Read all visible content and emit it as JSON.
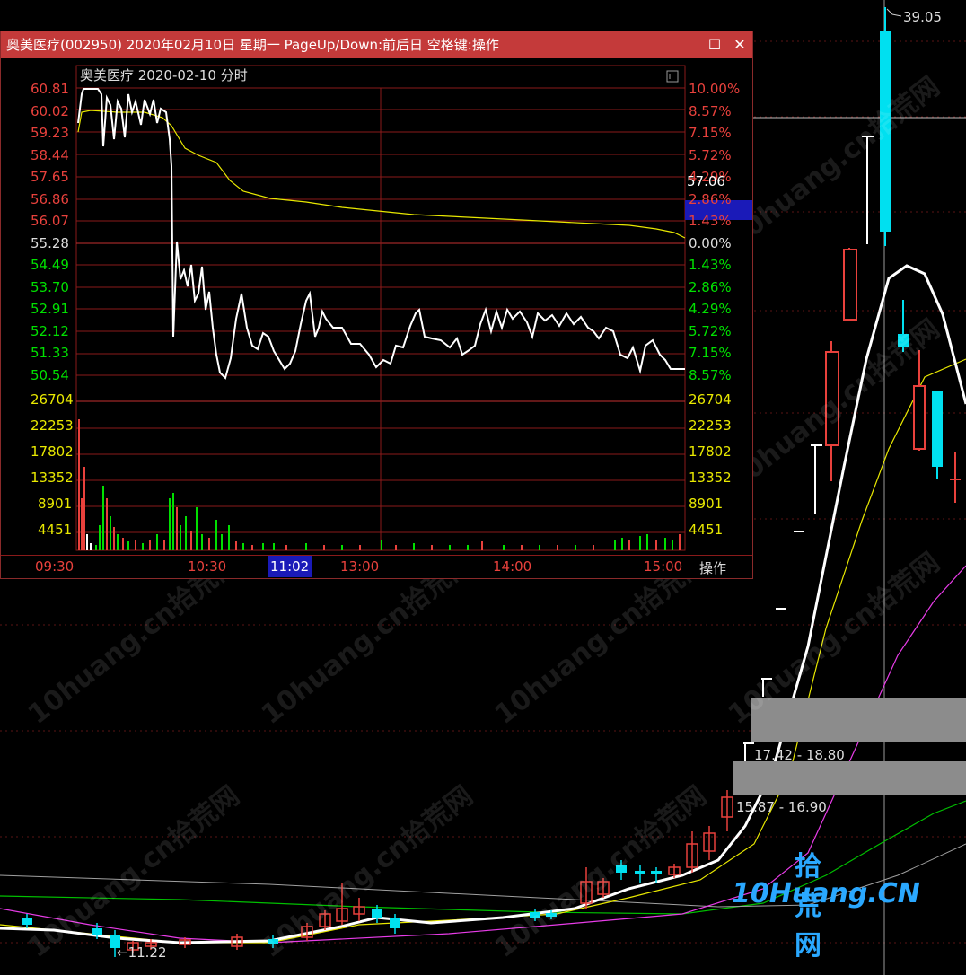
{
  "background_chart": {
    "price_high_label": "39.05",
    "price_low_label": "11.22",
    "range_labels": [
      "17.42 - 18.80",
      "15.87 - 16.90"
    ],
    "colors": {
      "up": "#e8413c",
      "down": "#00e0f0",
      "ma5": "#ffffff",
      "ma10": "#e8e800",
      "ma20": "#e83ce8",
      "ma60": "#00c000"
    }
  },
  "watermark": "10huang.cn拾荒网",
  "logo": {
    "cn": "拾荒网",
    "en": "10Huang.CN"
  },
  "popup": {
    "title": "奥美医疗(002950) 2020年02月10日 星期一 PageUp/Down:前后日 空格键:操作",
    "close_label": "✕",
    "maximize_label": "☐",
    "subtitle": "奥美医疗  2020-02-10 分时",
    "price_axis": [
      "60.81",
      "60.02",
      "59.23",
      "58.44",
      "57.65",
      "56.86",
      "56.07",
      "55.28",
      "54.49",
      "53.70",
      "52.91",
      "52.12",
      "51.33",
      "50.54"
    ],
    "pct_axis": [
      "10.00%",
      "8.57%",
      "7.15%",
      "5.72%",
      "4.29%",
      "2.86%",
      "1.43%",
      "0.00%",
      "1.43%",
      "2.86%",
      "4.29%",
      "5.72%",
      "7.15%",
      "8.57%"
    ],
    "volume_axis": [
      "26704",
      "22253",
      "17802",
      "13352",
      "8901",
      "4451"
    ],
    "time_axis": [
      "09:30",
      "10:30",
      "11:02",
      "13:00",
      "14:00",
      "15:00"
    ],
    "cursor_time": "11:02",
    "cursor_price": "57.06",
    "action_label": "操作",
    "colors": {
      "up_axis": "#e8413c",
      "down_axis": "#00e000",
      "grid": "#8a1a1a",
      "price_line": "#ffffff",
      "avg_line": "#e8e800",
      "volume_axis": "#e8e800"
    }
  }
}
